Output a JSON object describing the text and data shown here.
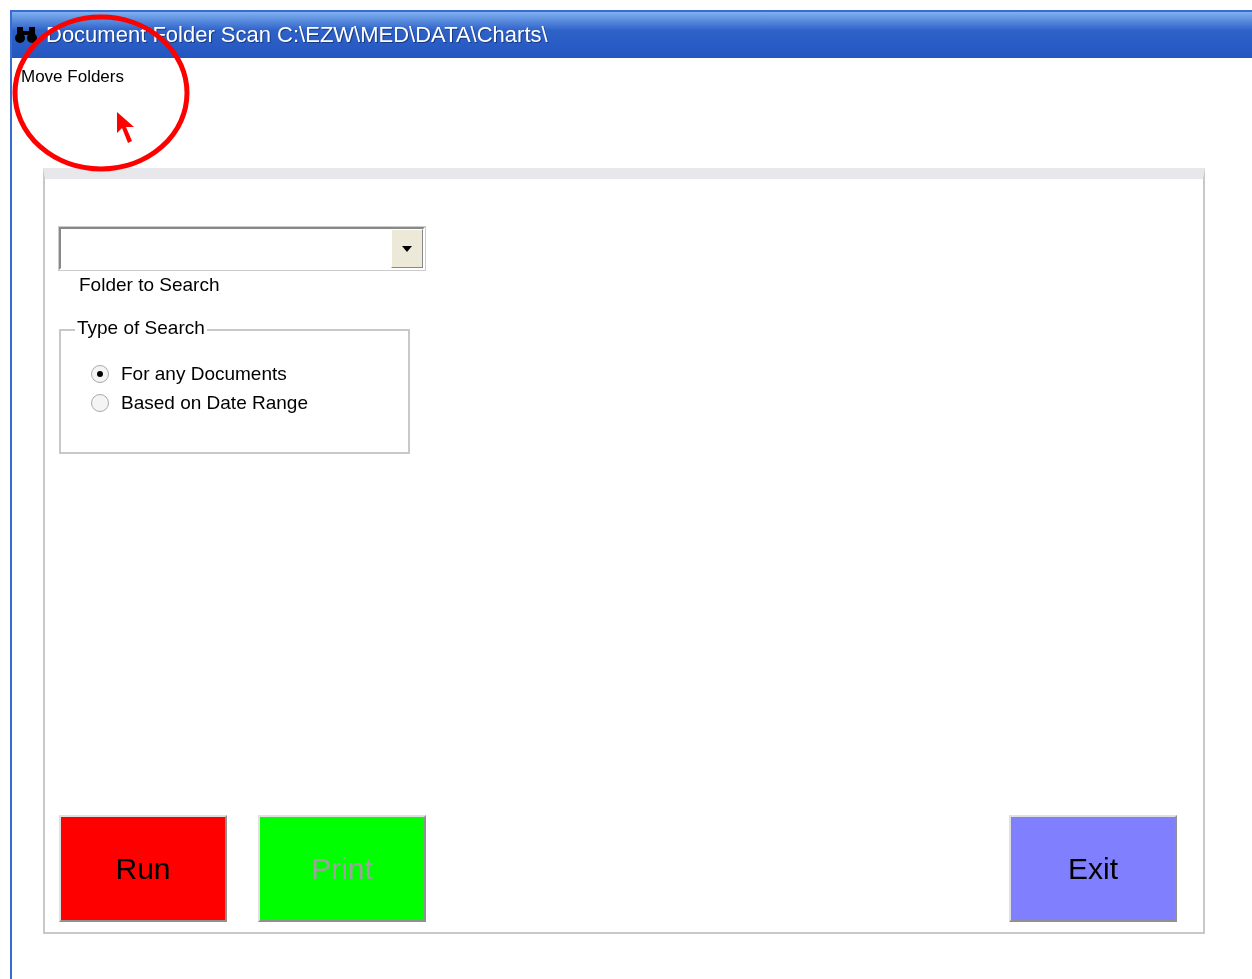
{
  "window": {
    "title": "Document Folder Scan C:\\EZW\\MED\\DATA\\Charts\\"
  },
  "menu": [
    {
      "label": "Move Folders"
    }
  ],
  "folder_field": {
    "label": "Folder to Search"
  },
  "search_type": {
    "title": "Type of Search",
    "options": [
      {
        "label": "For any Documents",
        "selected": true
      },
      {
        "label": "Based on Date Range",
        "selected": false
      }
    ]
  },
  "left_buttons": [
    {
      "label": "Run",
      "color": "#ff0000",
      "disabled": false
    },
    {
      "label": "Print",
      "color": "#00ff00",
      "disabled": true
    }
  ],
  "right_buttons": [
    {
      "label": "Exit",
      "color": "#8080ff",
      "disabled": false
    }
  ]
}
